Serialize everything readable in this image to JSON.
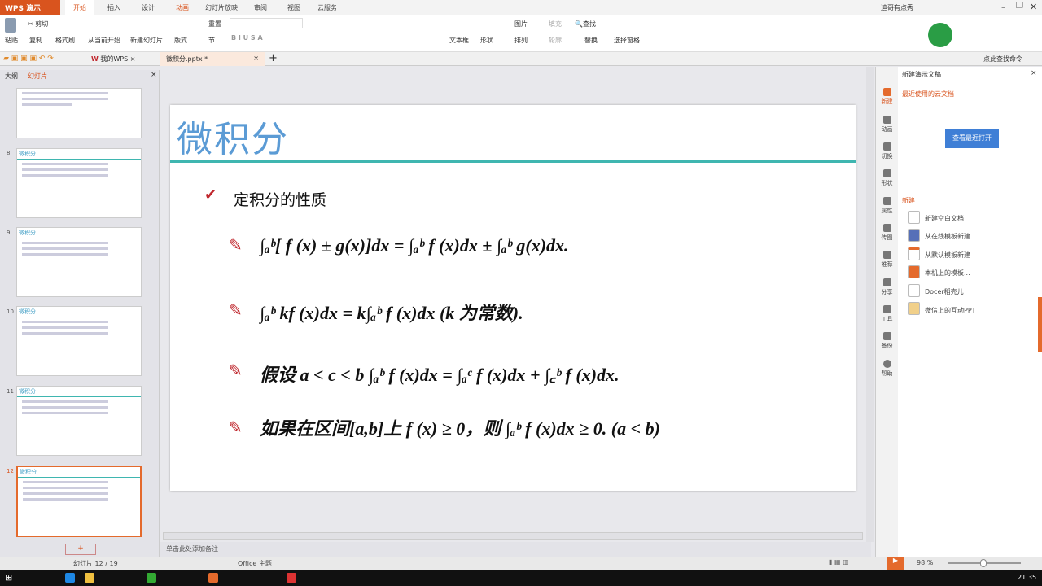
{
  "app": {
    "name": "WPS 演示",
    "tabs": [
      "开始",
      "插入",
      "设计",
      "动画",
      "幻灯片放映",
      "审阅",
      "视图",
      "云服务"
    ],
    "active_tab": "开始",
    "user": "迪哥有点秀"
  },
  "ribbon": {
    "cut": "剪切",
    "paste": "粘贴",
    "copy": "复制",
    "format_painter": "格式刷",
    "from_current": "从当前开始",
    "new_slide": "新建幻灯片",
    "layout": "版式",
    "reset": "重置",
    "section": "节",
    "textbox": "文本框",
    "shape": "形状",
    "picture": "图片",
    "arrange": "排列",
    "fill": "填充",
    "outline": "轮廓",
    "find": "查找",
    "replace": "替换",
    "select_pane": "选择窗格",
    "search_cmd": "点此查找命令"
  },
  "doc_tabs": [
    {
      "label": "我的WPS"
    },
    {
      "label": "微积分.pptx *"
    }
  ],
  "left_panel": {
    "tab_outline": "大纲",
    "tab_slides": "幻灯片",
    "thumbnails": [
      {
        "num": "",
        "title": ""
      },
      {
        "num": "8",
        "title": "微积分"
      },
      {
        "num": "9",
        "title": "微积分"
      },
      {
        "num": "10",
        "title": "微积分"
      },
      {
        "num": "11",
        "title": "微积分"
      },
      {
        "num": "12",
        "title": "微积分"
      }
    ]
  },
  "slide": {
    "title": "微积分",
    "heading": "定积分的性质",
    "formulas": [
      "∫ₐᵇ[ f (x) ± g(x)]dx = ∫ₐᵇ f (x)dx ± ∫ₐᵇ g(x)dx.",
      "∫ₐᵇ kf (x)dx = k∫ₐᵇ f (x)dx      (k 为常数).",
      "假设 a < c < b      ∫ₐᵇ f (x)dx = ∫ₐᶜ f (x)dx + ∫꜀ᵇ f (x)dx.",
      "如果在区间[a,b]上 f (x) ≥ 0，则 ∫ₐᵇ f (x)dx ≥ 0.    (a < b)"
    ]
  },
  "notes": {
    "placeholder": "单击此处添加备注"
  },
  "right_pane": {
    "title": "新建演示文稿",
    "recent": "最近使用的云文档",
    "open_recent": "查看最近打开",
    "new_section": "新建",
    "side": [
      "新建",
      "动画",
      "切换",
      "形状",
      "属性",
      "传图",
      "推荐",
      "分享",
      "工具",
      "备份",
      "帮助"
    ],
    "items": [
      "新建空白文档",
      "从在线模板新建...",
      "从默认模板新建",
      "本机上的模板...",
      "Docer稻壳儿",
      "微信上的互动PPT"
    ]
  },
  "status": {
    "slide": "幻灯片 12 / 19",
    "theme": "Office 主题",
    "zoom": "98 %",
    "zoom_value": 98,
    "time": "21:35"
  }
}
